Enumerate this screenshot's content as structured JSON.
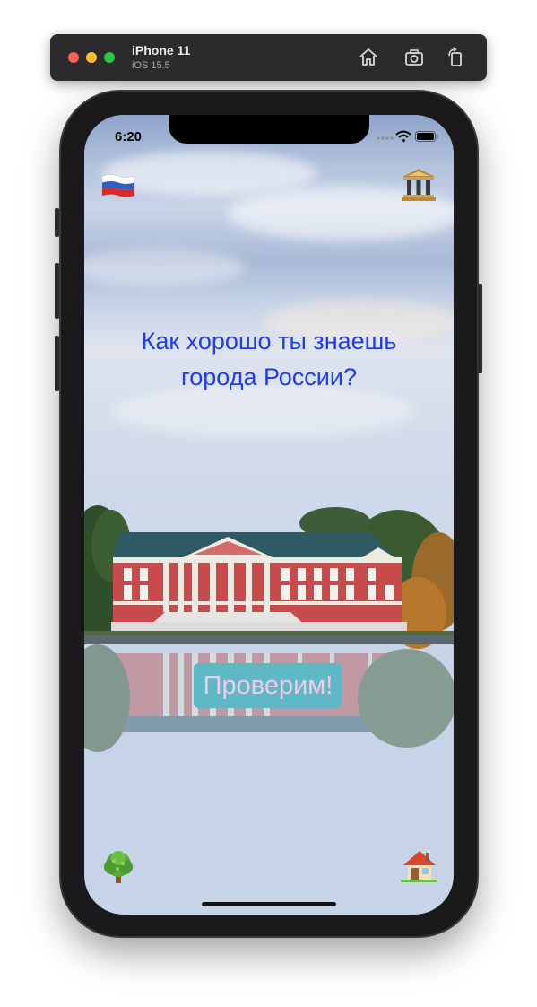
{
  "simulator": {
    "device_name": "iPhone 11",
    "os_version": "iOS 15.5",
    "toolbar_icons": [
      "home-icon",
      "screenshot-icon",
      "rotate-icon"
    ]
  },
  "status_bar": {
    "time": "6:20"
  },
  "app": {
    "headline_line1": "Как хорошо ты знаешь",
    "headline_line2": "города России?",
    "check_button_label": "Проверим!",
    "top_left_icon": "russia-flag-icon",
    "top_right_icon": "museum-icon",
    "bottom_left_icon": "tree-icon",
    "bottom_right_icon": "house-icon"
  },
  "colors": {
    "headline": "#1f3dea",
    "button_bg": "#5fb8c6",
    "button_text": "#f6c8e8"
  }
}
